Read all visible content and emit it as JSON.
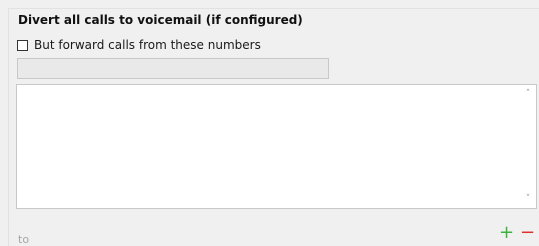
{
  "divert": {
    "heading": "Divert all calls to voicemail (if configured)",
    "forward_checkbox": {
      "label": "But forward calls from these numbers",
      "checked": false
    },
    "number_input": {
      "value": "",
      "placeholder": ""
    },
    "numbers_list": [],
    "scroll_up_icon": "˄",
    "scroll_down_icon": "˅"
  },
  "footer": {
    "to_label": "to",
    "add_glyph": "+",
    "remove_glyph": "−"
  },
  "colors": {
    "background": "#f0f0f0",
    "add": "#3cb23c",
    "remove": "#e0302b"
  }
}
